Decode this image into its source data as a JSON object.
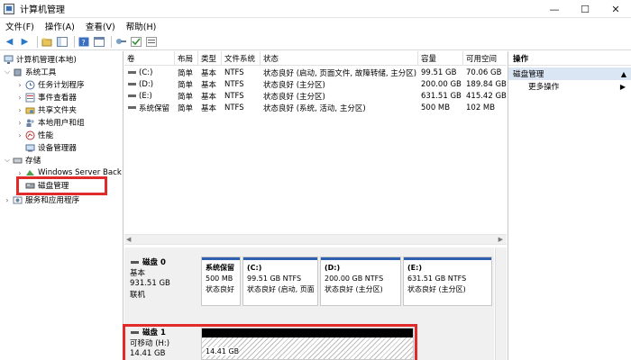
{
  "window": {
    "title": "计算机管理",
    "minimize": "—",
    "maximize": "☐",
    "close": "✕"
  },
  "menu": [
    "文件(F)",
    "操作(A)",
    "查看(V)",
    "帮助(H)"
  ],
  "tree": [
    {
      "label": "计算机管理(本地)"
    },
    {
      "label": "系统工具"
    },
    {
      "label": "任务计划程序"
    },
    {
      "label": "事件查看器"
    },
    {
      "label": "共享文件夹"
    },
    {
      "label": "本地用户和组"
    },
    {
      "label": "性能"
    },
    {
      "label": "设备管理器"
    },
    {
      "label": "存储"
    },
    {
      "label": "Windows Server Back"
    },
    {
      "label": "磁盘管理"
    },
    {
      "label": "服务和应用程序"
    }
  ],
  "volume_table": {
    "columns": [
      "卷",
      "布局",
      "类型",
      "文件系统",
      "状态",
      "容量",
      "可用空间"
    ],
    "rows": [
      {
        "vol": "(C:)",
        "layout": "简单",
        "type": "基本",
        "fs": "NTFS",
        "status": "状态良好 (启动, 页面文件, 故障转储, 主分区)",
        "cap": "99.51 GB",
        "free": "70.06 GB"
      },
      {
        "vol": "(D:)",
        "layout": "简单",
        "type": "基本",
        "fs": "NTFS",
        "status": "状态良好 (主分区)",
        "cap": "200.00 GB",
        "free": "189.84 GB"
      },
      {
        "vol": "(E:)",
        "layout": "简单",
        "type": "基本",
        "fs": "NTFS",
        "status": "状态良好 (主分区)",
        "cap": "631.51 GB",
        "free": "415.42 GB"
      },
      {
        "vol": "系统保留",
        "layout": "简单",
        "type": "基本",
        "fs": "NTFS",
        "status": "状态良好 (系统, 活动, 主分区)",
        "cap": "500 MB",
        "free": "102 MB"
      }
    ]
  },
  "disk0": {
    "name": "磁盘 0",
    "type": "基本",
    "size": "931.51 GB",
    "state": "联机",
    "partitions": [
      {
        "name": "系统保留",
        "size": "500 MB",
        "status": "状态良好"
      },
      {
        "name": "(C:)",
        "size": "99.51 GB NTFS",
        "status": "状态良好 (启动, 页面"
      },
      {
        "name": "(D:)",
        "size": "200.00 GB NTFS",
        "status": "状态良好 (主分区)"
      },
      {
        "name": "(E:)",
        "size": "631.51 GB NTFS",
        "status": "状态良好 (主分区)"
      }
    ]
  },
  "disk1": {
    "name": "磁盘 1",
    "type": "可移动 (H:)",
    "size": "14.41 GB",
    "partition_size": "14.41 GB"
  },
  "actions": {
    "title": "操作",
    "section": "磁盘管理",
    "more": "更多操作"
  },
  "colors": {
    "primary_bar": "#2f5fb0",
    "highlight_box": "#e12b2b",
    "selected_row": "#dbe6f4"
  }
}
